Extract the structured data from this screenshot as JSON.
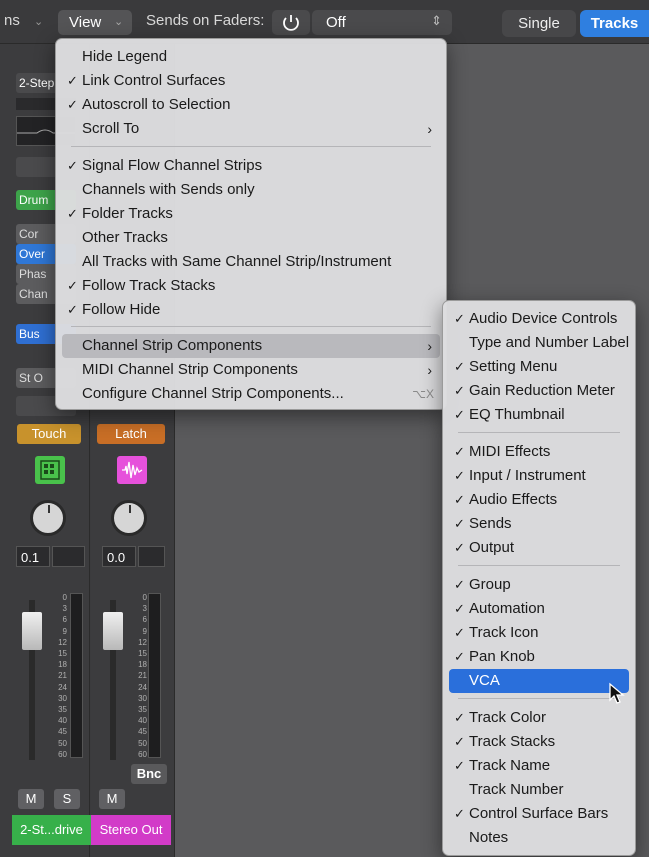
{
  "toolbar": {
    "left_fragment": "ns",
    "view_label": "View",
    "sends_on_faders_label": "Sends on Faders:",
    "sends_value": "Off",
    "single_label": "Single",
    "tracks_label": "Tracks"
  },
  "mixer": {
    "strip1_slots": [
      "2-Step",
      "Drum",
      "Cor",
      "Over",
      "Phas",
      "Chan",
      "Bus",
      "St O"
    ],
    "touch_label": "Touch",
    "latch_label": "Latch",
    "strip1_value": "0.1",
    "strip2_value": "0.0",
    "scale_ticks": [
      "0",
      "3",
      "6",
      "9",
      "12",
      "15",
      "18",
      "21",
      "24",
      "30",
      "35",
      "40",
      "45",
      "50",
      "60"
    ],
    "bnc_label": "Bnc",
    "mute_label": "M",
    "solo_label": "S",
    "strip1_name": "2-St...drive",
    "strip2_name": "Stereo Out"
  },
  "view_menu": {
    "items": [
      {
        "label": "Hide Legend",
        "checked": false
      },
      {
        "label": "Link Control Surfaces",
        "checked": true
      },
      {
        "label": "Autoscroll to Selection",
        "checked": true
      },
      {
        "label": "Scroll To",
        "checked": false,
        "submenu": true
      },
      {
        "label": "Signal Flow Channel Strips",
        "checked": true
      },
      {
        "label": "Channels with Sends only",
        "checked": false
      },
      {
        "label": "Folder Tracks",
        "checked": true
      },
      {
        "label": "Other Tracks",
        "checked": false
      },
      {
        "label": "All Tracks with Same Channel Strip/Instrument",
        "checked": false
      },
      {
        "label": "Follow Track Stacks",
        "checked": true
      },
      {
        "label": "Follow Hide",
        "checked": true
      },
      {
        "label": "Channel Strip Components",
        "checked": false,
        "submenu": true,
        "highlighted": true
      },
      {
        "label": "MIDI Channel Strip Components",
        "checked": false,
        "submenu": true
      },
      {
        "label": "Configure Channel Strip Components...",
        "checked": false,
        "shortcut": "⌥X"
      }
    ]
  },
  "components_menu": {
    "items": [
      {
        "label": "Audio Device Controls",
        "checked": true
      },
      {
        "label": "Type and Number Label",
        "checked": false
      },
      {
        "label": "Setting Menu",
        "checked": true
      },
      {
        "label": "Gain Reduction Meter",
        "checked": true
      },
      {
        "label": "EQ Thumbnail",
        "checked": true
      },
      {
        "label": "MIDI Effects",
        "checked": true
      },
      {
        "label": "Input / Instrument",
        "checked": true
      },
      {
        "label": "Audio Effects",
        "checked": true
      },
      {
        "label": "Sends",
        "checked": true
      },
      {
        "label": "Output",
        "checked": true
      },
      {
        "label": "Group",
        "checked": true
      },
      {
        "label": "Automation",
        "checked": true
      },
      {
        "label": "Track Icon",
        "checked": true
      },
      {
        "label": "Pan Knob",
        "checked": true
      },
      {
        "label": "VCA",
        "checked": false,
        "selected": true
      },
      {
        "label": "Track Color",
        "checked": true
      },
      {
        "label": "Track Stacks",
        "checked": true
      },
      {
        "label": "Track Name",
        "checked": true
      },
      {
        "label": "Track Number",
        "checked": false
      },
      {
        "label": "Control Surface Bars",
        "checked": true
      },
      {
        "label": "Notes",
        "checked": false
      }
    ]
  },
  "glyphs": {
    "check": "✓",
    "submenu_arrow": "›",
    "view_chevron": "⌄",
    "popup_arrows": "⇕",
    "power": "⏻"
  }
}
